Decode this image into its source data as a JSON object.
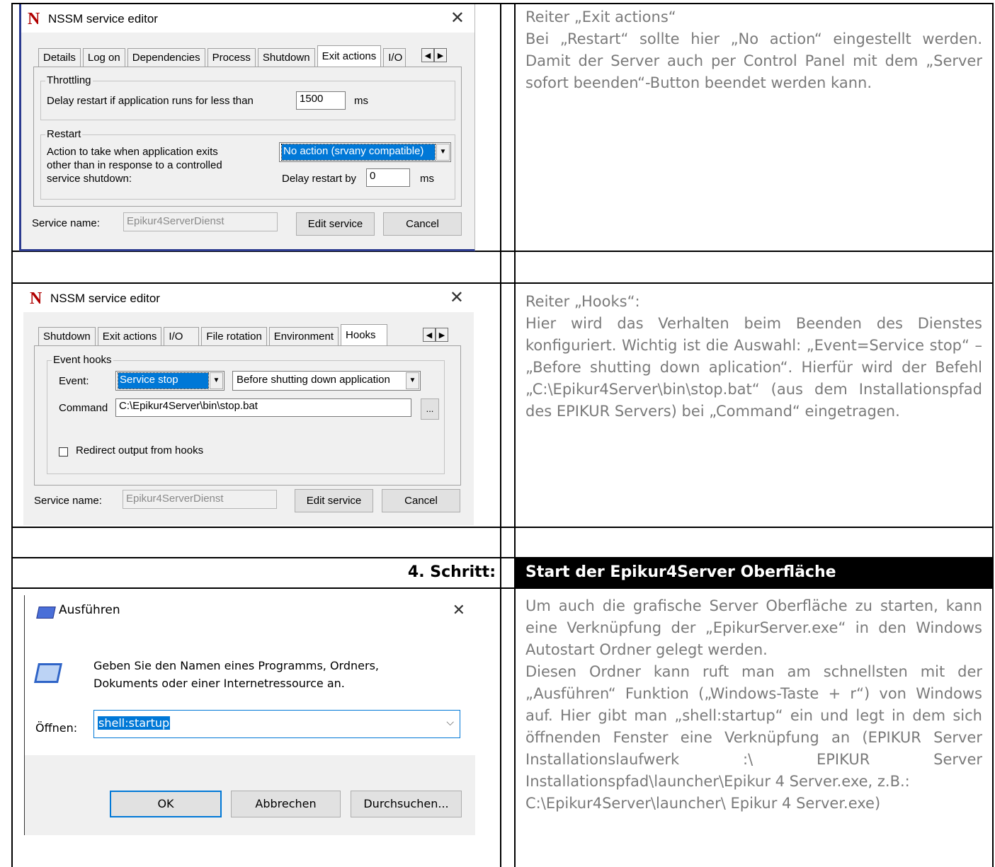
{
  "row1": {
    "window": {
      "logo": "N",
      "title": "NSSM service editor",
      "close": "✕",
      "tabs": [
        "Details",
        "Log on",
        "Dependencies",
        "Process",
        "Shutdown",
        "Exit actions",
        "I/O"
      ],
      "active_tab": "Exit actions",
      "throttling_label": "Throttling",
      "delay_label": "Delay restart if application runs for less than",
      "delay_value": "1500",
      "delay_unit": "ms",
      "restart_label": "Restart",
      "action_text": "Action to take when application exits other than in response to a controlled service shutdown:",
      "action_value": "No action (srvany compatible)",
      "delay_restart_label": "Delay restart by",
      "delay_restart_value": "0",
      "delay_restart_unit": "ms",
      "service_name_label": "Service name:",
      "service_name_value": "Epikur4ServerDienst",
      "edit_button": "Edit service",
      "cancel_button": "Cancel"
    },
    "description": [
      "Reiter „Exit actions“",
      "Bei „Restart“ sollte hier „No action“ eingestellt werden. Damit der Server auch per Control Panel mit dem „Server sofort beenden“-Button beendet werden kann."
    ]
  },
  "row2": {
    "window": {
      "logo": "N",
      "title": "NSSM service editor",
      "close": "✕",
      "tabs": [
        "Shutdown",
        "Exit actions",
        "I/O",
        "File rotation",
        "Environment",
        "Hooks"
      ],
      "active_tab": "Hooks",
      "event_hooks_label": "Event hooks",
      "event_label": "Event:",
      "event_value": "Service stop",
      "event_when_value": "Before shutting down application",
      "command_label": "Command",
      "command_value": "C:\\Epikur4Server\\bin\\stop.bat",
      "browse_button": "...",
      "redirect_label": "Redirect output from hooks",
      "service_name_label": "Service name:",
      "service_name_value": "Epikur4ServerDienst",
      "edit_button": "Edit service",
      "cancel_button": "Cancel"
    },
    "description": [
      "Reiter „Hooks“:",
      "Hier wird das Verhalten beim Beenden des Dienstes konfiguriert. Wichtig ist die Auswahl: „Event=Service stop“ – „Before shutting down aplication“. Hierfür wird der Befehl „C:\\Epikur4Server\\bin\\stop.bat“ (aus dem Installationspfad des EPIKUR Servers) bei „Command“ eingetragen."
    ]
  },
  "step": {
    "label": "4. Schritt:",
    "heading": "Start der Epikur4Server Oberfläche"
  },
  "row3": {
    "window": {
      "title": "Ausführen",
      "close": "✕",
      "prompt": "Geben Sie den Namen eines Programms, Ordners, Dokuments oder einer Internetressource an.",
      "open_label": "Öffnen:",
      "open_value": "shell:startup",
      "ok_button": "OK",
      "cancel_button": "Abbrechen",
      "browse_button": "Durchsuchen..."
    },
    "description": [
      "Um auch die grafische Server Oberfläche zu starten, kann eine Verknüpfung der „EpikurServer.exe“ in den Windows Autostart Ordner gelegt werden.",
      "Diesen Ordner kann ruft man am schnellsten mit der „Ausführen“ Funktion („Windows-Taste + r“) von Windows auf. Hier gibt man „shell:startup“ ein und legt in dem sich öffnenden Fenster eine Verknüpfung an (EPIKUR Server Installationslaufwerk :\\ EPIKUR Server Installationspfad\\launcher\\Epikur 4 Server.exe, z.B.:",
      "C:\\Epikur4Server\\launcher\\ Epikur 4 Server.exe)"
    ]
  }
}
